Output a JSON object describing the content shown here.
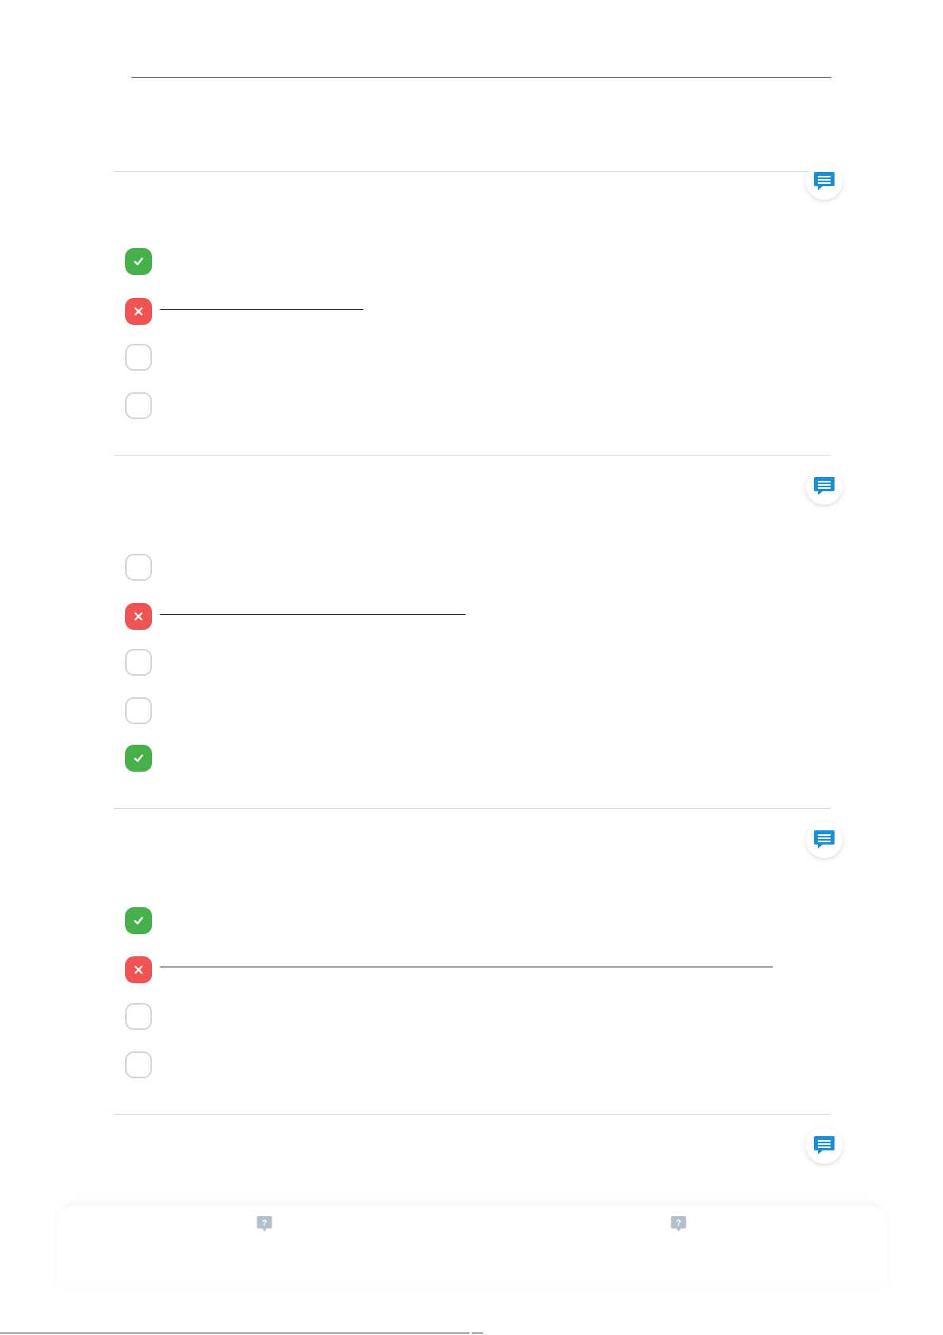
{
  "page_mark": "·",
  "colors": {
    "correct": "#46b04a",
    "wrong": "#f05352",
    "unselected_border": "#d4d4d4",
    "comment_icon": "#1a8fd6",
    "help_icon": "#b3bfcc"
  },
  "icons": {
    "correct": "check-icon",
    "wrong": "cross-icon",
    "comment": "comment-icon",
    "help": "question-icon"
  },
  "questions": [
    {
      "options": [
        "correct",
        "wrong",
        "empty",
        "empty"
      ]
    },
    {
      "options": [
        "empty",
        "wrong",
        "empty",
        "empty",
        "correct"
      ]
    },
    {
      "options": [
        "correct",
        "wrong",
        "empty",
        "empty"
      ]
    },
    {
      "options": []
    }
  ]
}
